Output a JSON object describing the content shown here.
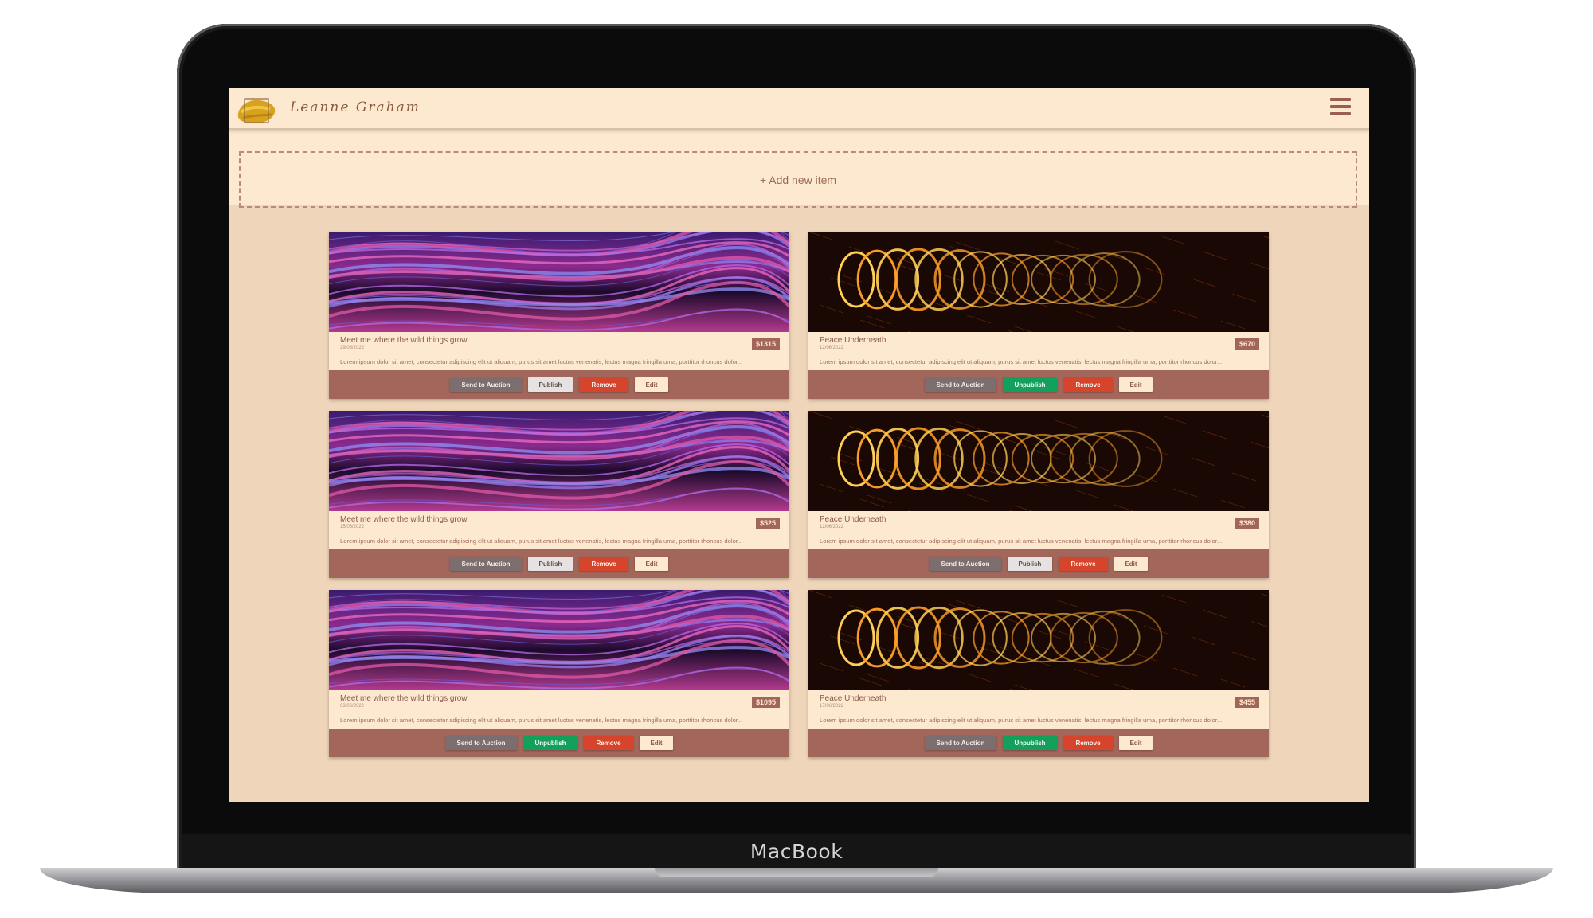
{
  "device": {
    "brand": "MacBook"
  },
  "header": {
    "logo_text": "Leanne Graham",
    "logo_icon": "gold-brush-logo-icon",
    "menu_icon": "hamburger-menu-icon"
  },
  "add_item": {
    "label": "+ Add new item"
  },
  "description": "Lorem ipsum dolor sit amet, consectetur adipiscing elit ut aliquam, purus sit amet luctus venenatis, lectus magna fringilla urna, porttitor rhoncus dolor...",
  "buttons": {
    "auction": "Send to Auction",
    "publish": "Publish",
    "unpublish": "Unpublish",
    "remove": "Remove",
    "edit": "Edit"
  },
  "colors": {
    "screen_bg": "#efd5b9",
    "header_bg": "#fde8d0",
    "action_bar": "#a2665a",
    "unpublish": "#13a05c",
    "remove": "#d6442b"
  },
  "cards": [
    {
      "title": "Meet me where the wild things grow",
      "date": "29/06/2022",
      "price": "$1315",
      "published": false,
      "image": "purple-light-waves"
    },
    {
      "title": "Peace Underneath",
      "date": "12/06/2022",
      "price": "$670",
      "published": true,
      "image": "orange-fire-spiral"
    },
    {
      "title": "Meet me where the wild things grow",
      "date": "15/06/2022",
      "price": "$525",
      "published": false,
      "image": "purple-light-waves"
    },
    {
      "title": "Peace Underneath",
      "date": "12/06/2022",
      "price": "$380",
      "published": false,
      "image": "orange-fire-spiral"
    },
    {
      "title": "Meet me where the wild things grow",
      "date": "03/06/2022",
      "price": "$1095",
      "published": true,
      "image": "purple-light-waves"
    },
    {
      "title": "Peace Underneath",
      "date": "17/06/2022",
      "price": "$455",
      "published": true,
      "image": "orange-fire-spiral"
    }
  ]
}
